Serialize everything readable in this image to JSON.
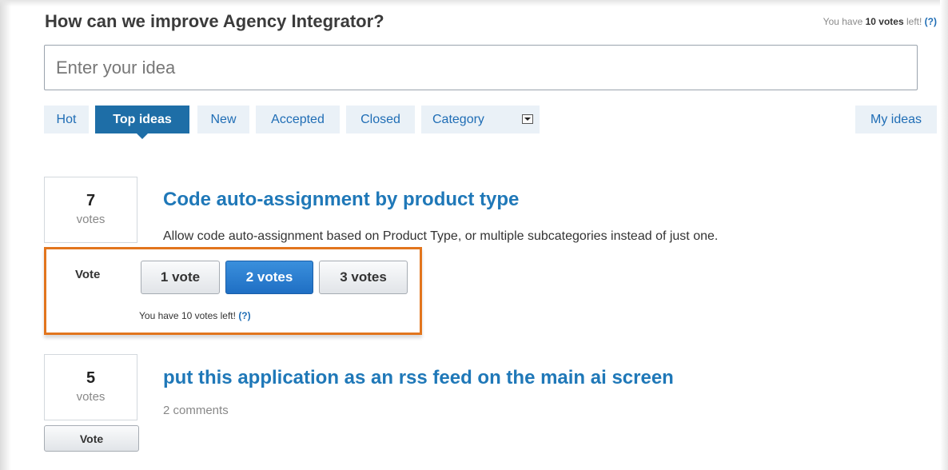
{
  "header": {
    "title": "How can we improve Agency Integrator?",
    "votes_left_prefix": "You have ",
    "votes_left_count": "10 votes",
    "votes_left_suffix": " left! ",
    "help_label": "(?)"
  },
  "search": {
    "placeholder": "Enter your idea"
  },
  "tabs": [
    {
      "label": "Hot"
    },
    {
      "label": "Top ideas",
      "active": true
    },
    {
      "label": "New"
    },
    {
      "label": "Accepted"
    },
    {
      "label": "Closed"
    },
    {
      "label": "Category",
      "icon": "dropdown-arrow-icon"
    }
  ],
  "my_ideas_label": "My ideas",
  "ideas": [
    {
      "votes": "7",
      "votes_unit": "votes",
      "title": "Code auto-assignment by product type",
      "description": "Allow code auto-assignment based on Product Type, or multiple subcategories instead of just one."
    },
    {
      "votes": "5",
      "votes_unit": "votes",
      "title": "put this application as an rss feed on the main ai screen",
      "comments": "2 comments",
      "vote_button": "Vote"
    }
  ],
  "vote_panel": {
    "label": "Vote",
    "options": [
      "1 vote",
      "2 votes",
      "3 votes"
    ],
    "selected_index": 1,
    "note": "You have 10 votes left! ",
    "help_label": "(?)",
    "border_color": "#e2751d"
  },
  "colors": {
    "accent": "#1e6ea7",
    "link": "#1f78b8",
    "tab_bg": "#eaf1f7"
  }
}
